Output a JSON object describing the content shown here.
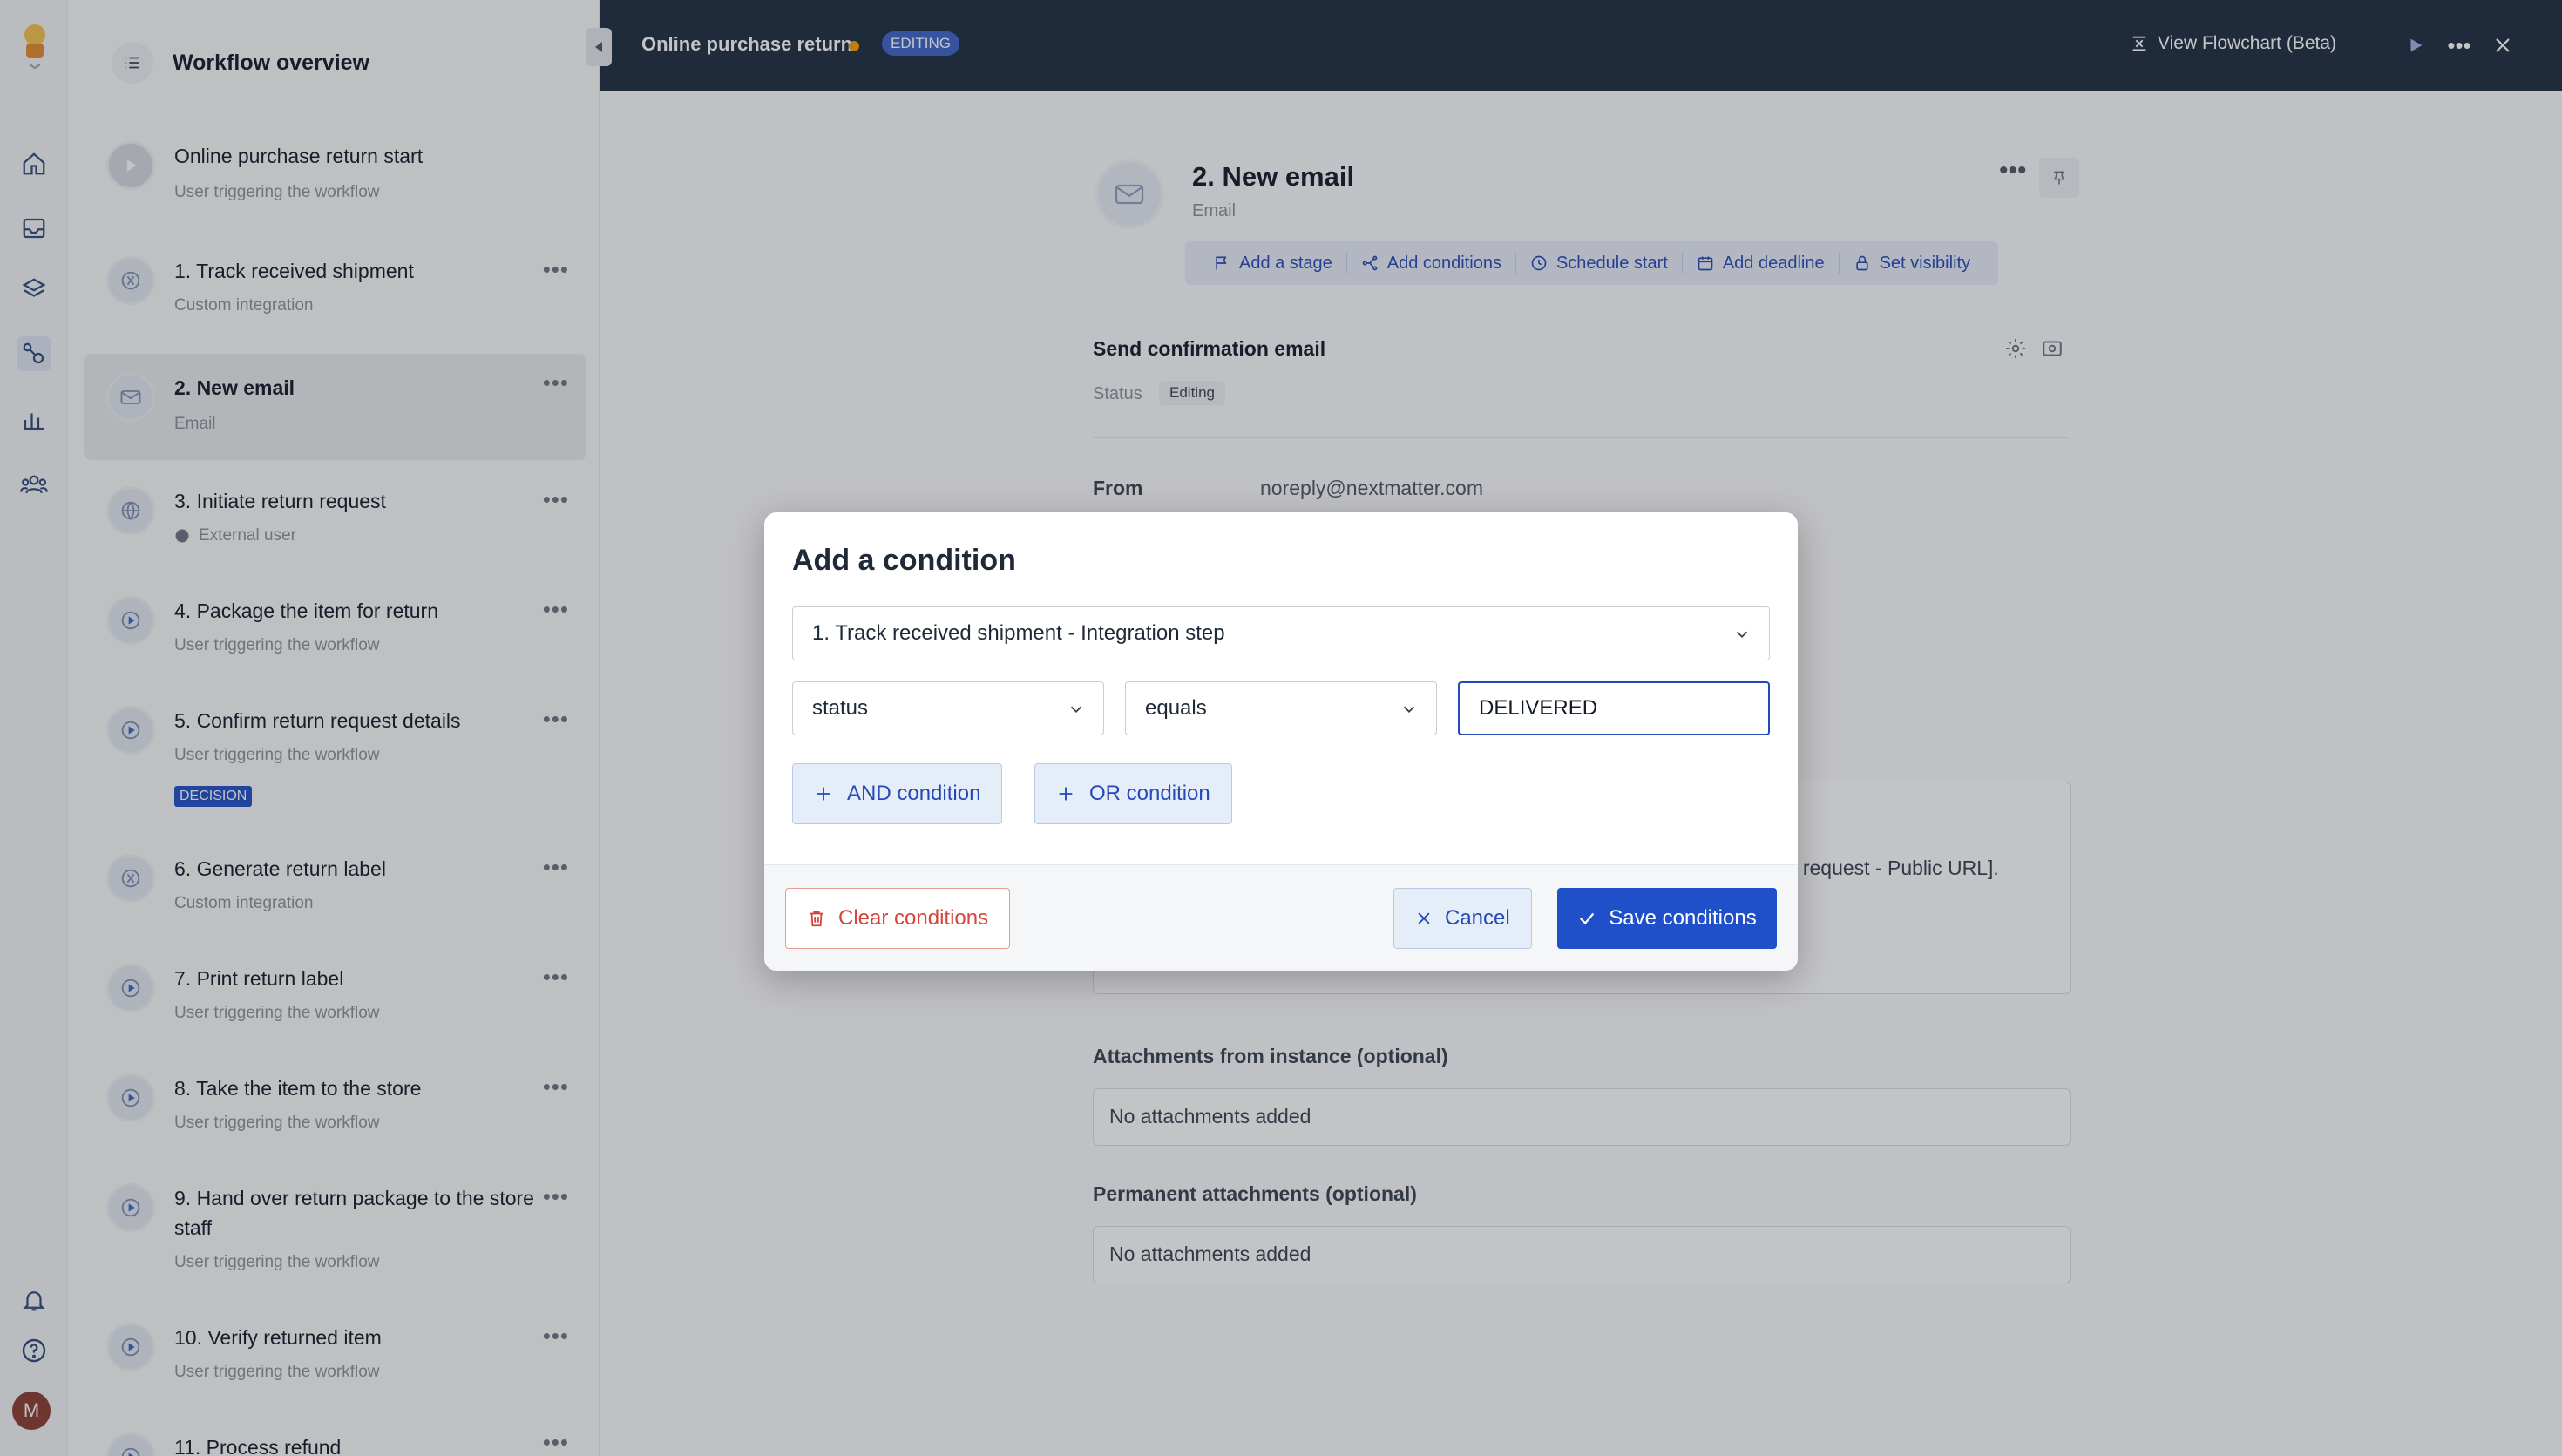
{
  "app": {
    "workflow_title": "Online purchase return",
    "mode_badge": "EDITING",
    "view_flowchart": "View Flowchart (Beta)",
    "user_initial": "M"
  },
  "sidebar": {
    "title": "Workflow overview",
    "items": [
      {
        "title": "Online purchase return start",
        "subtitle": "User triggering the workflow",
        "icon": "play-icon"
      },
      {
        "title": "1. Track received shipment",
        "subtitle": "Custom integration",
        "icon": "integration-icon"
      },
      {
        "title": "2. New email",
        "subtitle": "Email",
        "icon": "mail-icon"
      },
      {
        "title": "3. Initiate return request",
        "subtitle": "External user",
        "icon": "globe-icon"
      },
      {
        "title": "4. Package the item for return",
        "subtitle": "User triggering the workflow",
        "icon": "user-step-icon"
      },
      {
        "title": "5. Confirm return request details",
        "subtitle": "User triggering the workflow",
        "icon": "user-step-icon",
        "badge": "DECISION"
      },
      {
        "title": "6. Generate return label",
        "subtitle": "Custom integration",
        "icon": "integration-icon"
      },
      {
        "title": "7. Print return label",
        "subtitle": "User triggering the workflow",
        "icon": "user-step-icon"
      },
      {
        "title": "8. Take the item to the store",
        "subtitle": "User triggering the workflow",
        "icon": "user-step-icon"
      },
      {
        "title": "9. Hand over return package to the store staff",
        "subtitle": "User triggering the workflow",
        "icon": "user-step-icon"
      },
      {
        "title": "10. Verify returned item",
        "subtitle": "User triggering the workflow",
        "icon": "user-step-icon"
      },
      {
        "title": "11. Process refund",
        "subtitle": "",
        "icon": "user-step-icon"
      }
    ]
  },
  "step": {
    "name": "2. New email",
    "type": "Email",
    "actions": [
      "Add a stage",
      "Add conditions",
      "Schedule start",
      "Add deadline",
      "Set visibility"
    ],
    "section_title": "Send confirmation email",
    "status_label": "Status",
    "status_value": "Editing",
    "from_label": "From",
    "from_value": "noreply@nextmatter.com",
    "body_fragment": "rn request - Public URL].",
    "attachments_instance_title": "Attachments from instance (optional)",
    "attachments_instance_value": "No attachments added",
    "attachments_permanent_title": "Permanent attachments (optional)",
    "attachments_permanent_value": "No attachments added"
  },
  "modal": {
    "title": "Add a condition",
    "source_select": "1. Track received shipment - Integration step",
    "field_select": "status",
    "operator_select": "equals",
    "value_input": "DELIVERED",
    "and_button": "AND condition",
    "or_button": "OR condition",
    "clear_button": "Clear conditions",
    "cancel_button": "Cancel",
    "save_button": "Save conditions"
  },
  "colors": {
    "topbar": "#1c2a3f",
    "primary": "#1f4fc9",
    "danger": "#d9443a",
    "editing_dot": "#f59e0b"
  }
}
